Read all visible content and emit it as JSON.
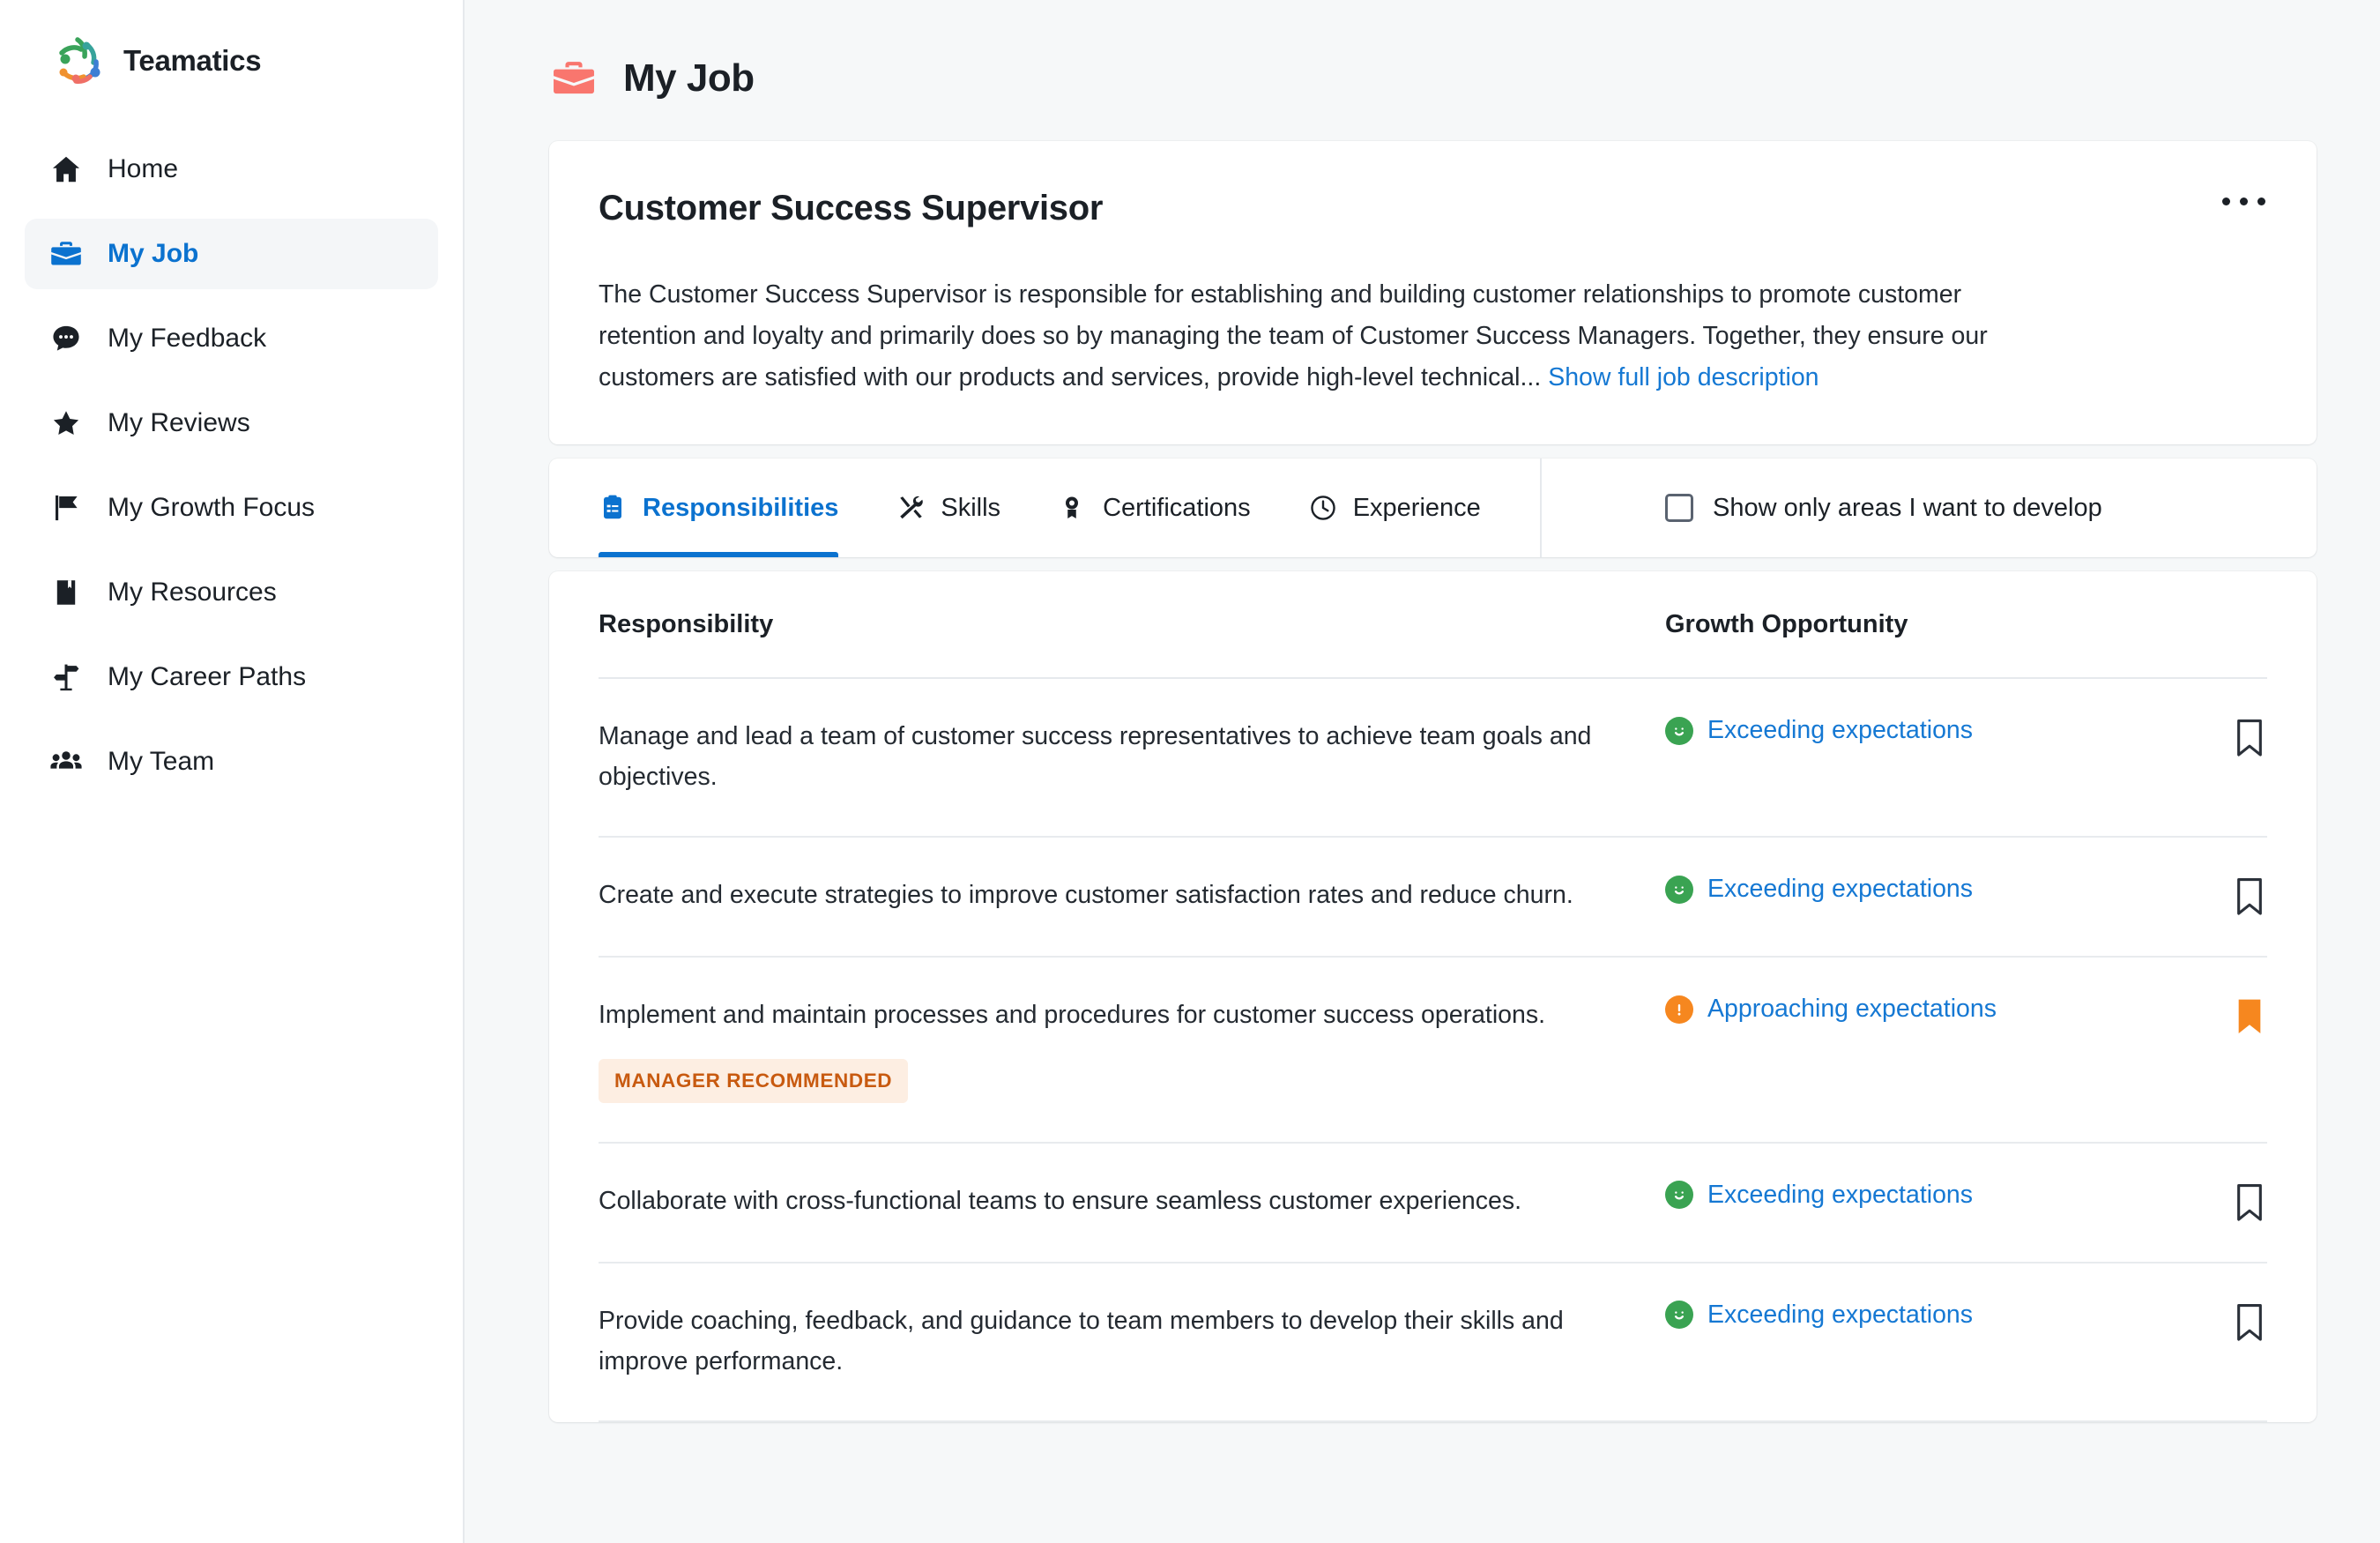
{
  "brand": {
    "name": "Teamatics",
    "logo_icon": "teamatics-logo"
  },
  "sidebar": {
    "items": [
      {
        "label": "Home",
        "icon": "home-icon",
        "active": false
      },
      {
        "label": "My Job",
        "icon": "briefcase-icon",
        "active": true
      },
      {
        "label": "My Feedback",
        "icon": "chat-bubble-icon",
        "active": false
      },
      {
        "label": "My Reviews",
        "icon": "star-icon",
        "active": false
      },
      {
        "label": "My Growth Focus",
        "icon": "flag-icon",
        "active": false
      },
      {
        "label": "My Resources",
        "icon": "book-icon",
        "active": false
      },
      {
        "label": "My Career Paths",
        "icon": "signpost-icon",
        "active": false
      },
      {
        "label": "My Team",
        "icon": "people-group-icon",
        "active": false
      }
    ]
  },
  "page": {
    "title": "My Job",
    "icon": "briefcase-icon"
  },
  "job": {
    "title": "Customer Success Supervisor",
    "menu_icon": "more-horizontal-icon",
    "description": "The Customer Success Supervisor is responsible for establishing and building customer relationships to promote customer retention and loyalty and primarily does so by managing the team of Customer Success Managers. Together, they ensure our customers are satisfied with our products and services, provide high-level technical...",
    "show_full_link": "Show full job description"
  },
  "tabs": [
    {
      "label": "Responsibilities",
      "icon": "clipboard-list-icon",
      "active": true
    },
    {
      "label": "Skills",
      "icon": "tools-icon",
      "active": false
    },
    {
      "label": "Certifications",
      "icon": "medal-icon",
      "active": false
    },
    {
      "label": "Experience",
      "icon": "clock-icon",
      "active": false
    }
  ],
  "filter": {
    "checkbox_label": "Show only areas I want to develop",
    "checked": false
  },
  "table": {
    "columns": {
      "responsibility": "Responsibility",
      "growth": "Growth Opportunity"
    },
    "rows": [
      {
        "responsibility": "Manage and lead a team of customer success representatives to achieve team goals and objectives.",
        "badge": null,
        "growth_status": "Exceeding expectations",
        "growth_icon": "smiley-face-icon",
        "growth_icon_color": "#3aa352",
        "bookmark": "bookmark-outline-icon",
        "bookmarked": false
      },
      {
        "responsibility": "Create and execute strategies to improve customer satisfaction rates and reduce churn.",
        "badge": null,
        "growth_status": "Exceeding expectations",
        "growth_icon": "smiley-face-icon",
        "growth_icon_color": "#3aa352",
        "bookmark": "bookmark-outline-icon",
        "bookmarked": false
      },
      {
        "responsibility": "Implement and maintain processes and procedures for customer success operations.",
        "badge": "MANAGER RECOMMENDED",
        "growth_status": "Approaching expectations",
        "growth_icon": "exclamation-circle-icon",
        "growth_icon_color": "#f6871f",
        "bookmark": "bookmark-filled-icon",
        "bookmarked": true
      },
      {
        "responsibility": "Collaborate with cross-functional teams to ensure seamless customer experiences.",
        "badge": null,
        "growth_status": "Exceeding expectations",
        "growth_icon": "smiley-face-icon",
        "growth_icon_color": "#3aa352",
        "bookmark": "bookmark-outline-icon",
        "bookmarked": false
      },
      {
        "responsibility": "Provide coaching, feedback, and guidance to team members to develop their skills and improve performance.",
        "badge": null,
        "growth_status": "Exceeding expectations",
        "growth_icon": "smiley-face-icon",
        "growth_icon_color": "#3aa352",
        "bookmark": "bookmark-outline-icon",
        "bookmarked": false
      }
    ]
  },
  "colors": {
    "accent_blue": "#0b72cf",
    "link_blue": "#1578d3",
    "green": "#3aa352",
    "orange": "#f6871f",
    "badge_bg": "#fdeee2",
    "badge_text": "#c85a10",
    "page_bg": "#f6f8f9",
    "coral": "#f9766e"
  }
}
